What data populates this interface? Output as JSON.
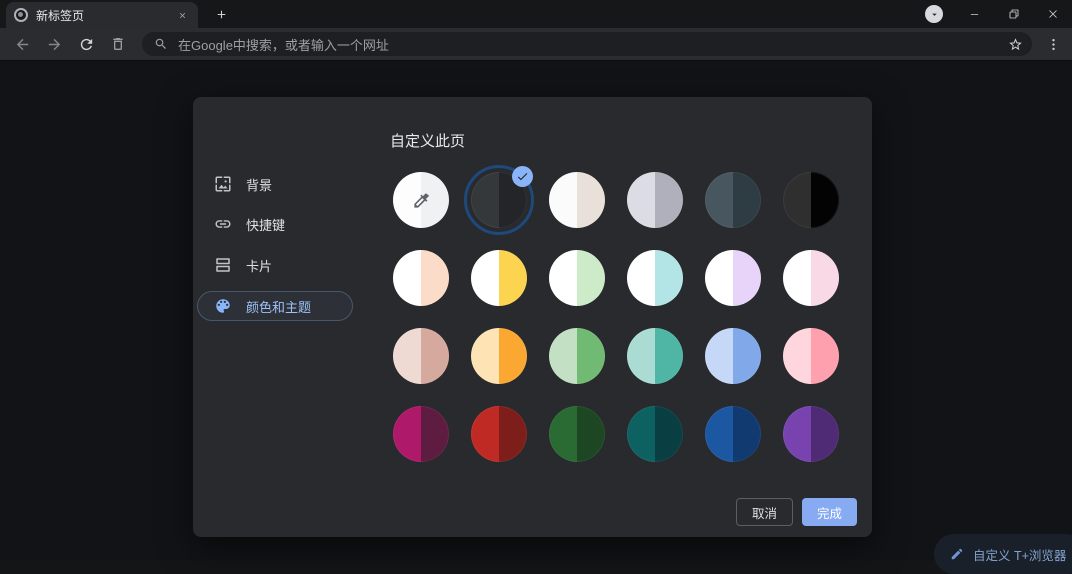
{
  "window": {
    "tab": {
      "title": "新标签页"
    }
  },
  "toolbar": {
    "omnibox": {
      "placeholder": "在Google中搜索，或者输入一个网址"
    }
  },
  "dialog": {
    "title": "自定义此页",
    "sidebar": [
      {
        "label": "背景",
        "icon": "wallpaper-icon",
        "selected": false
      },
      {
        "label": "快捷键",
        "icon": "link-icon",
        "selected": false
      },
      {
        "label": "卡片",
        "icon": "cards-icon",
        "selected": false
      },
      {
        "label": "颜色和主题",
        "icon": "palette-icon",
        "selected": true
      }
    ],
    "swatches": [
      {
        "type": "eyedropper",
        "left": "#fdfdfd",
        "right": "#f0f1f3",
        "selected": false
      },
      {
        "left": "#35383b",
        "right": "#232528",
        "selected": true
      },
      {
        "left": "#fbfbfb",
        "right": "#e9e0d9",
        "selected": false
      },
      {
        "left": "#dcdce4",
        "right": "#b0b0bc",
        "selected": false
      },
      {
        "left": "#47565f",
        "right": "#2e3c44",
        "selected": false
      },
      {
        "left": "#2f2f2f",
        "right": "#030303",
        "selected": false
      },
      {
        "left": "#ffffff",
        "right": "#fbdcc8",
        "selected": false
      },
      {
        "left": "#ffffff",
        "right": "#fcd44f",
        "selected": false
      },
      {
        "left": "#ffffff",
        "right": "#cdeac9",
        "selected": false
      },
      {
        "left": "#ffffff",
        "right": "#b4e5e6",
        "selected": false
      },
      {
        "left": "#ffffff",
        "right": "#e7d4f8",
        "selected": false
      },
      {
        "left": "#ffffff",
        "right": "#f9d9e6",
        "selected": false
      },
      {
        "left": "#eedad3",
        "right": "#d6a99e",
        "selected": false
      },
      {
        "left": "#fee3b4",
        "right": "#faa832",
        "selected": false
      },
      {
        "left": "#c3e0c4",
        "right": "#71ba74",
        "selected": false
      },
      {
        "left": "#abdcd3",
        "right": "#4fb6a6",
        "selected": false
      },
      {
        "left": "#c5d8f7",
        "right": "#81a9e9",
        "selected": false
      },
      {
        "left": "#ffd6de",
        "right": "#ffa0af",
        "selected": false
      },
      {
        "left": "#ae1a69",
        "right": "#5e1c40",
        "selected": false
      },
      {
        "left": "#c02a25",
        "right": "#7e1e1a",
        "selected": false
      },
      {
        "left": "#2a6a33",
        "right": "#1d4723",
        "selected": false
      },
      {
        "left": "#0e6161",
        "right": "#093e43",
        "selected": false
      },
      {
        "left": "#1c58a2",
        "right": "#113a70",
        "selected": false
      },
      {
        "left": "#7843af",
        "right": "#4f2a75",
        "selected": false
      }
    ],
    "footer": {
      "cancel_label": "取消",
      "done_label": "完成"
    }
  },
  "page": {
    "customize_button_label": "自定义 T+浏览器"
  },
  "colors": {
    "accent": "#8ab4f8",
    "selected_ring": "#1d4a7d",
    "dialog_bg": "#292a2d",
    "done_button_bg": "#86abf3"
  }
}
